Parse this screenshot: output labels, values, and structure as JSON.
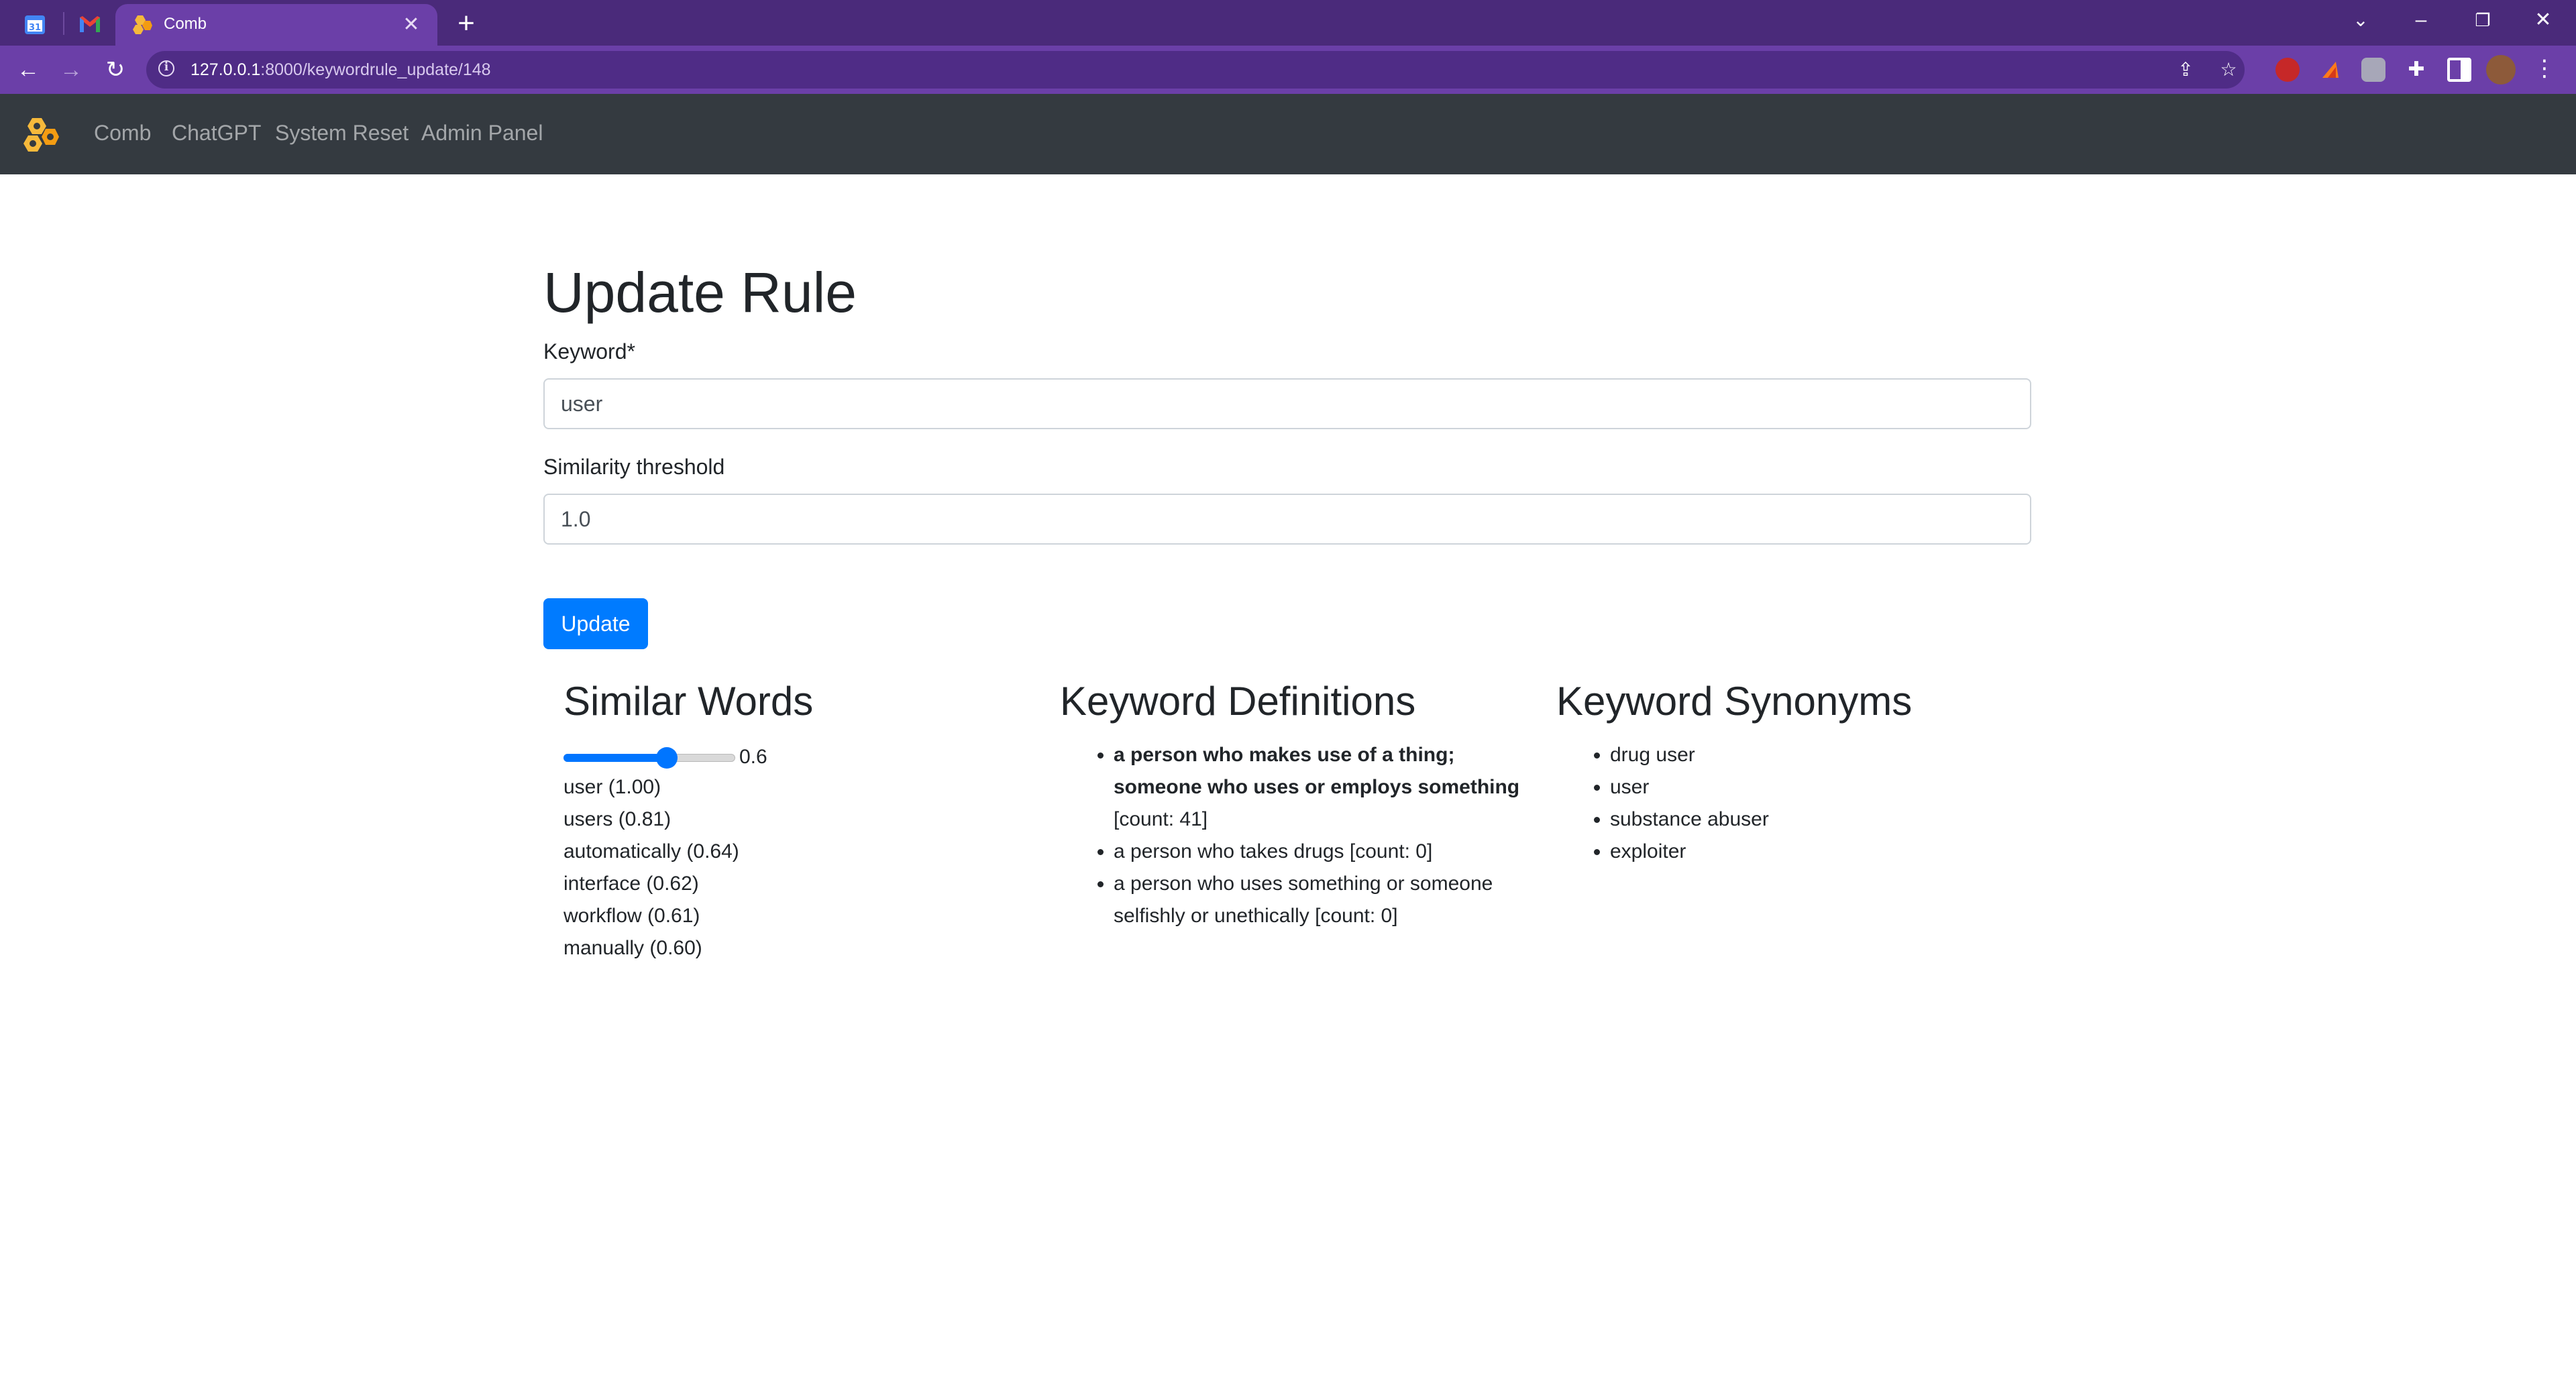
{
  "browser": {
    "tab_title": "Comb",
    "url_host": "127.0.0.1",
    "url_path": ":8000/keywordrule_update/148"
  },
  "navbar": {
    "links": [
      "Comb",
      "ChatGPT",
      "System Reset",
      "Admin Panel"
    ]
  },
  "form": {
    "title": "Update Rule",
    "keyword_label": "Keyword*",
    "keyword_value": "user",
    "threshold_label": "Similarity threshold",
    "threshold_value": "1.0",
    "submit_label": "Update"
  },
  "similar_words": {
    "heading": "Similar Words",
    "slider_value": "0.6",
    "slider_fraction": 0.6,
    "items": [
      "user (1.00)",
      "users (0.81)",
      "automatically (0.64)",
      "interface (0.62)",
      "workflow (0.61)",
      "manually (0.60)"
    ]
  },
  "definitions": {
    "heading": "Keyword Definitions",
    "items": [
      {
        "text": "a person who makes use of a thing; someone who uses or employs something",
        "count": " [count: 41]",
        "bold": true
      },
      {
        "text": "a person who takes drugs",
        "count": " [count: 0]",
        "bold": false
      },
      {
        "text": "a person who uses something or someone selfishly or unethically",
        "count": " [count: 0]",
        "bold": false
      }
    ]
  },
  "synonyms": {
    "heading": "Keyword Synonyms",
    "items": [
      "drug user",
      "user",
      "substance abuser",
      "exploiter"
    ]
  },
  "colors": {
    "chrome_tabbar": "#4a2a7a",
    "chrome_toolbar": "#6b3fa8",
    "navbar": "#343a40",
    "primary": "#007bff"
  }
}
